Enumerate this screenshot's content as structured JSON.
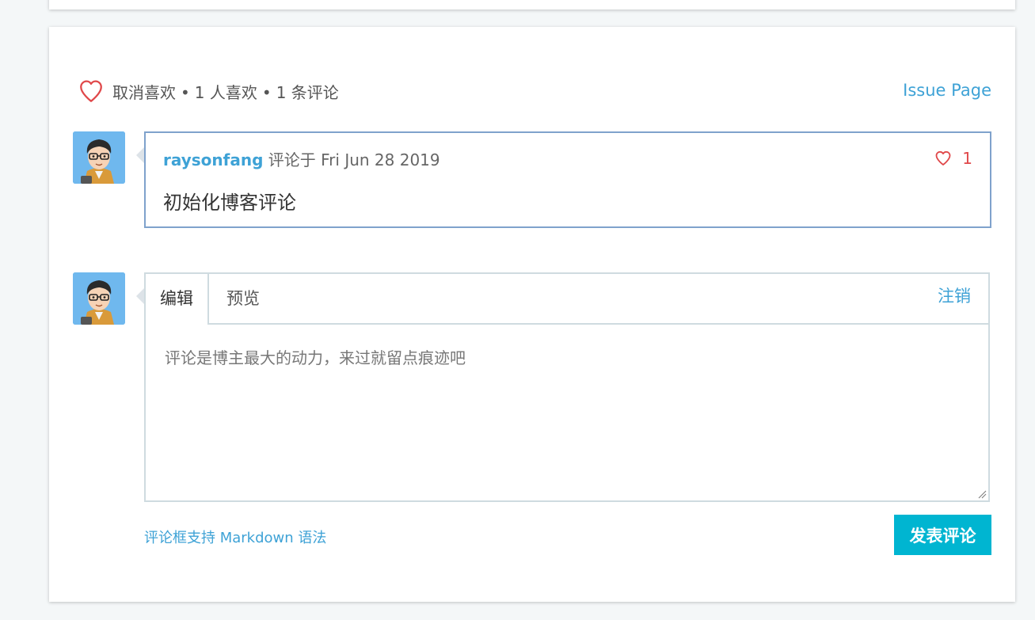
{
  "reactions": {
    "unlike_label": "取消喜欢",
    "separator": "•",
    "likes_text": "1 人喜欢",
    "comments_text": "1 条评论",
    "issue_link": "Issue Page"
  },
  "comment": {
    "username": "raysonfang",
    "meta": "评论于 Fri Jun 28 2019",
    "like_count": "1",
    "body": "初始化博客评论"
  },
  "editor": {
    "tab_edit": "编辑",
    "tab_preview": "预览",
    "logout": "注销",
    "placeholder": "评论是博主最大的动力，来过就留点痕迹吧",
    "value": "",
    "markdown_hint": "评论框支持 Markdown 语法",
    "submit_label": "发表评论"
  },
  "icons": {
    "like": "heart-outline-icon",
    "avatar": "cartoon-avatar"
  },
  "colors": {
    "link": "#3ea2d6",
    "heart": "#e0484a",
    "button": "#00b5d1",
    "comment_border": "#7fa2cc",
    "editor_border": "#cfdbe0"
  }
}
